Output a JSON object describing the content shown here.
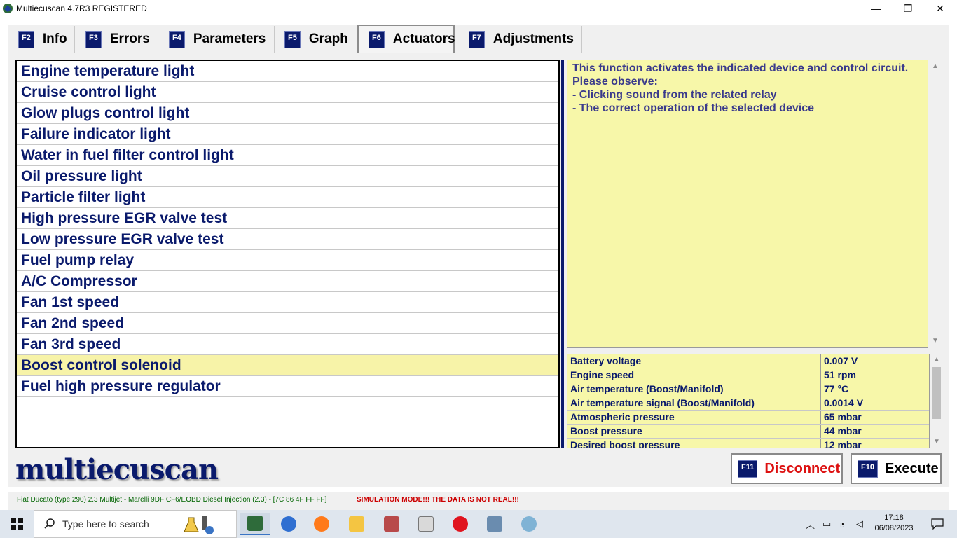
{
  "window": {
    "title": "Multiecuscan 4.7R3 REGISTERED",
    "minimize_glyph": "—",
    "maximize_glyph": "❐",
    "close_glyph": "✕"
  },
  "tabs": [
    {
      "key": "F2",
      "label": "Info"
    },
    {
      "key": "F3",
      "label": "Errors"
    },
    {
      "key": "F4",
      "label": "Parameters"
    },
    {
      "key": "F5",
      "label": "Graph"
    },
    {
      "key": "F6",
      "label": "Actuators",
      "active": true
    },
    {
      "key": "F7",
      "label": "Adjustments"
    }
  ],
  "actuators": [
    "Engine temperature light",
    "Cruise control light",
    "Glow plugs control light",
    "Failure indicator light",
    "Water in fuel filter control light",
    "Oil pressure light",
    "Particle filter light",
    "High pressure EGR valve test",
    "Low pressure EGR valve test",
    "Fuel pump relay",
    "A/C Compressor",
    "Fan 1st speed",
    "Fan 2nd speed",
    "Fan 3rd speed",
    "Boost control solenoid",
    "Fuel high pressure regulator"
  ],
  "selected_actuator": "Boost control solenoid",
  "description": [
    "This function activates the indicated device and control circuit.",
    "Please observe:",
    "- Clicking sound from the related relay",
    "- The correct operation of the selected device"
  ],
  "parameters": [
    {
      "name": "Battery voltage",
      "value": "0.007 V"
    },
    {
      "name": "Engine speed",
      "value": "51 rpm"
    },
    {
      "name": "Air temperature (Boost/Manifold)",
      "value": "77 °C"
    },
    {
      "name": "Air temperature signal (Boost/Manifold)",
      "value": "0.0014 V"
    },
    {
      "name": "Atmospheric pressure",
      "value": "65 mbar"
    },
    {
      "name": "Boost pressure",
      "value": "44 mbar"
    },
    {
      "name": "Desired boost pressure",
      "value": "12 mbar"
    }
  ],
  "logo": "multiecuscan",
  "buttons": {
    "disconnect": {
      "key": "F11",
      "label": "Disconnect"
    },
    "execute": {
      "key": "F10",
      "label": "Execute"
    }
  },
  "status": {
    "vehicle": "Fiat Ducato (type 290) 2.3 Multijet - Marelli 9DF CF6/EOBD Diesel Injection (2.3) - [7C 86 4F FF FF]",
    "warning": "SIMULATION MODE!!! THE DATA IS NOT REAL!!!"
  },
  "taskbar": {
    "search_placeholder": "Type here to search",
    "time": "17:18",
    "date": "06/08/2023"
  },
  "colors": {
    "accent_navy": "#0a1a6c",
    "highlight_yellow": "#f7f3a8",
    "disconnect_red": "#dd1111",
    "status_green": "#006400",
    "warning_red": "#cc0000"
  }
}
